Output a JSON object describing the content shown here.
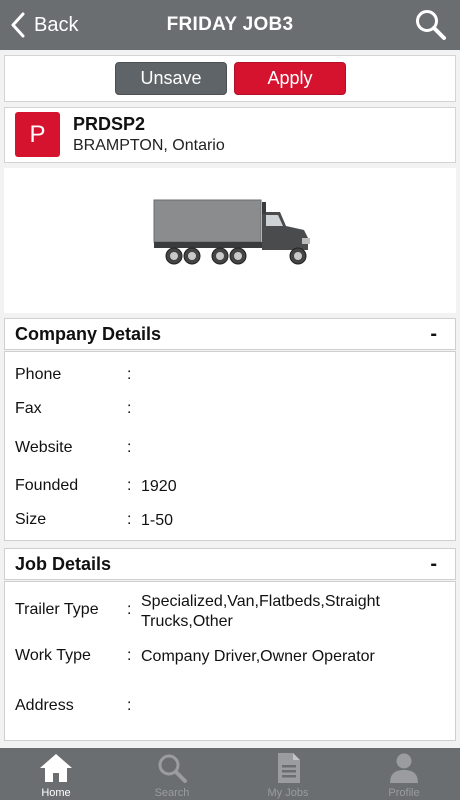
{
  "header": {
    "back_label": "Back",
    "title": "FRIDAY JOB3"
  },
  "actions": {
    "unsave_label": "Unsave",
    "apply_label": "Apply"
  },
  "company": {
    "logo_letter": "P",
    "name": "PRDSP2",
    "location": "BRAMPTON, Ontario"
  },
  "company_details": {
    "title": "Company Details",
    "toggle": "-",
    "rows": [
      {
        "label": "Phone",
        "value": ""
      },
      {
        "label": "Fax",
        "value": ""
      },
      {
        "label": "Website",
        "value": ""
      },
      {
        "label": "Founded",
        "value": "1920"
      },
      {
        "label": "Size",
        "value": "1-50"
      }
    ]
  },
  "job_details": {
    "title": "Job Details",
    "toggle": "-",
    "rows": [
      {
        "label": "Trailer Type",
        "value": "Specialized,Van,Flatbeds,Straight Trucks,Other"
      },
      {
        "label": "Work Type",
        "value": "Company Driver,Owner Operator"
      },
      {
        "label": "Address",
        "value": ""
      }
    ]
  },
  "separator": ":",
  "tabs": [
    {
      "label": "Home",
      "icon": "home-icon",
      "active": true
    },
    {
      "label": "Search",
      "icon": "search-icon",
      "active": false
    },
    {
      "label": "My Jobs",
      "icon": "document-icon",
      "active": false
    },
    {
      "label": "Profile",
      "icon": "person-icon",
      "active": false
    }
  ],
  "colors": {
    "header_bg": "#6b6e71",
    "accent_red": "#d6132f",
    "unsave_gray": "#5f6468",
    "tab_active": "#ffffff",
    "tab_inactive": "#9a9c9f"
  }
}
